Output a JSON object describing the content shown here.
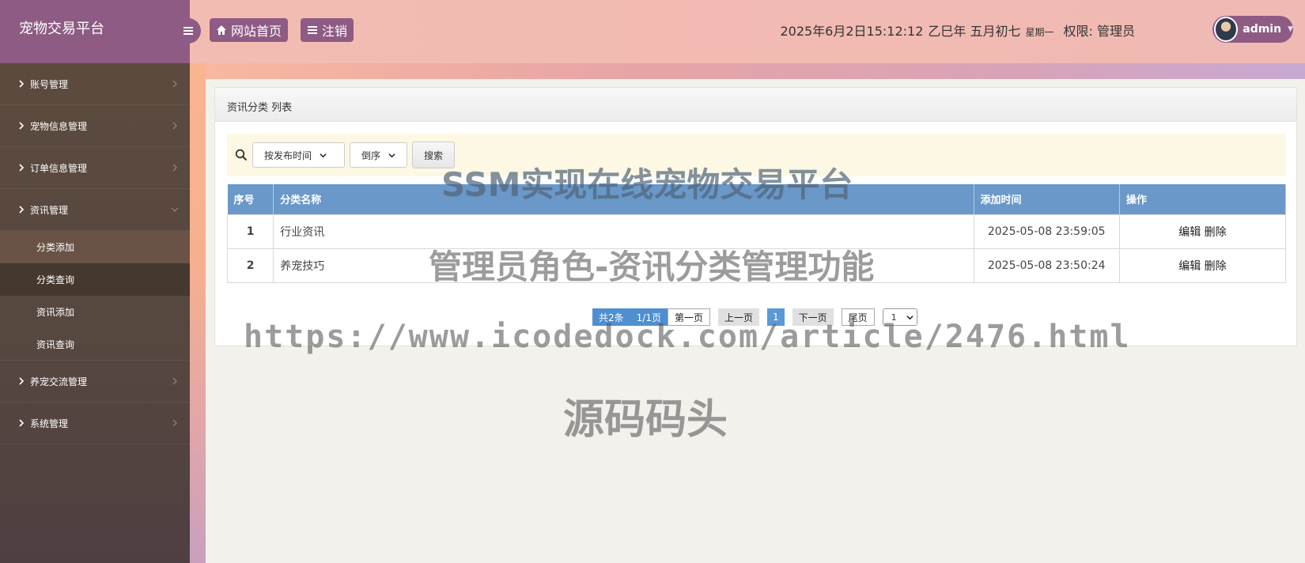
{
  "app": {
    "title": "宠物交易平台"
  },
  "header": {
    "home_label": "网站首页",
    "logout_label": "注销",
    "datetime": "2025年6月2日15:12:12",
    "lunar": "乙巳年 五月初七",
    "weekday": "星期一",
    "role_label": "权限: 管理员",
    "username": "admin"
  },
  "sidebar": {
    "items": [
      {
        "label": "账号管理"
      },
      {
        "label": "宠物信息管理"
      },
      {
        "label": "订单信息管理"
      },
      {
        "label": "资讯管理",
        "expanded": true,
        "children": [
          {
            "label": "分类添加"
          },
          {
            "label": "分类查询",
            "active": true
          },
          {
            "label": "资讯添加"
          },
          {
            "label": "资讯查询"
          }
        ]
      },
      {
        "label": "养宠交流管理"
      },
      {
        "label": "系统管理"
      }
    ]
  },
  "panel": {
    "title": "资讯分类 列表",
    "search": {
      "sort_field": "按发布时间",
      "sort_order": "倒序",
      "button": "搜索"
    },
    "table": {
      "headers": [
        "序号",
        "分类名称",
        "添加时间",
        "操作"
      ],
      "rows": [
        {
          "id": "1",
          "name": "行业资讯",
          "time": "2025-05-08 23:59:05",
          "edit": "编辑",
          "delete": "删除"
        },
        {
          "id": "2",
          "name": "养宠技巧",
          "time": "2025-05-08 23:50:24",
          "edit": "编辑",
          "delete": "删除"
        }
      ]
    },
    "pager": {
      "total": "共2条",
      "pages": "1/1页",
      "first": "第一页",
      "prev": "上一页",
      "current": "1",
      "next": "下一页",
      "last": "尾页",
      "jump_value": "1"
    }
  },
  "watermarks": [
    "SSM实现在线宠物交易平台",
    "管理员角色-资讯分类管理功能",
    "https://www.icodedock.com/article/2476.html",
    "源码码头"
  ],
  "colors": {
    "brand": "#8e5b84",
    "table_header": "#6a98c8",
    "search_bg": "#fdf8e4",
    "sidebar": "#56473f"
  }
}
